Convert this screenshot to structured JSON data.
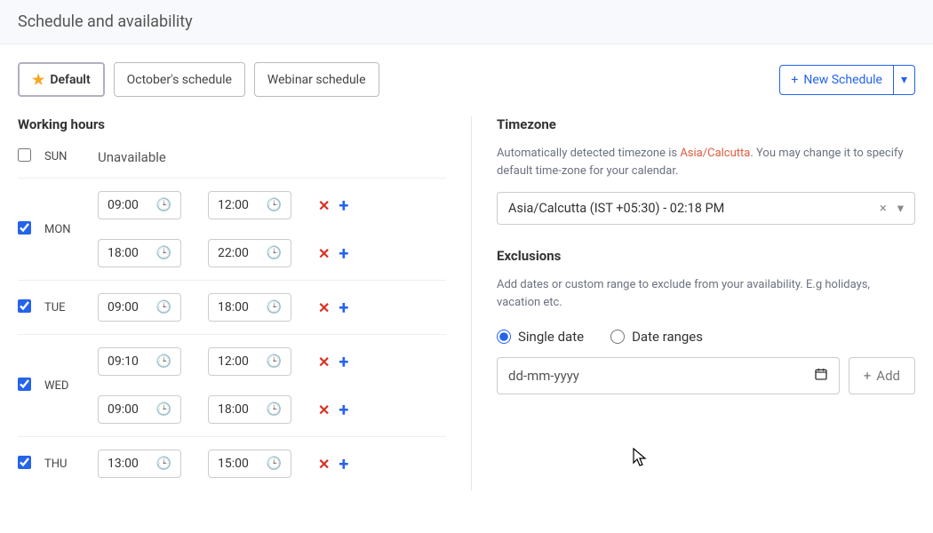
{
  "page_title": "Schedule and availability",
  "tabs": [
    {
      "label": "Default",
      "starred": true,
      "active": true
    },
    {
      "label": "October's schedule",
      "starred": false,
      "active": false
    },
    {
      "label": "Webinar schedule",
      "starred": false,
      "active": false
    }
  ],
  "new_schedule_label": "New Schedule",
  "working_hours_title": "Working hours",
  "days": [
    {
      "name": "SUN",
      "enabled": false,
      "unavailable_label": "Unavailable",
      "slots": []
    },
    {
      "name": "MON",
      "enabled": true,
      "slots": [
        {
          "start": "09:00",
          "end": "12:00"
        },
        {
          "start": "18:00",
          "end": "22:00"
        }
      ]
    },
    {
      "name": "TUE",
      "enabled": true,
      "slots": [
        {
          "start": "09:00",
          "end": "18:00"
        }
      ]
    },
    {
      "name": "WED",
      "enabled": true,
      "slots": [
        {
          "start": "09:10",
          "end": "12:00"
        },
        {
          "start": "09:00",
          "end": "18:00"
        }
      ]
    },
    {
      "name": "THU",
      "enabled": true,
      "slots": [
        {
          "start": "13:00",
          "end": "15:00"
        }
      ]
    }
  ],
  "timezone": {
    "title": "Timezone",
    "description_pre": "Automatically detected timezone is ",
    "detected": "Asia/Calcutta",
    "description_post": ". You may change it to specify default time-zone for your calendar.",
    "selected": "Asia/Calcutta  (IST +05:30)   -   02:18 PM"
  },
  "exclusions": {
    "title": "Exclusions",
    "description": "Add dates or custom range to exclude from your availability. E.g holidays, vacation etc.",
    "mode_single": "Single date",
    "mode_range": "Date ranges",
    "date_placeholder": "dd-mm-yyyy",
    "add_label": "Add"
  }
}
